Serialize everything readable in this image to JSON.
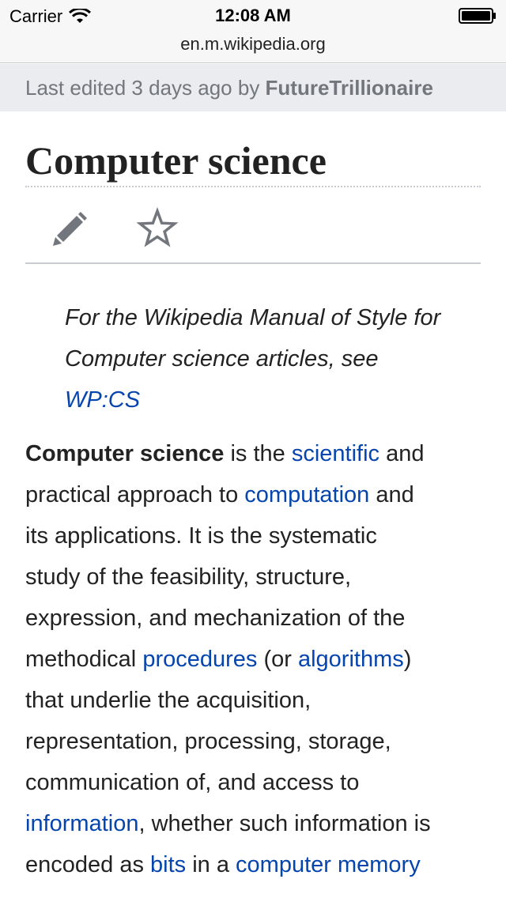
{
  "status_bar": {
    "carrier": "Carrier",
    "time": "12:08 AM"
  },
  "url_bar": {
    "url": "en.m.wikipedia.org"
  },
  "banner": {
    "prefix": "Last edited 3 days ago by ",
    "editor": "FutureTrillionaire"
  },
  "article": {
    "title": "Computer science",
    "hatnote": {
      "text_1": "For the Wikipedia Manual of Style for",
      "text_2": "Computer science articles, see",
      "link": "WP:CS"
    },
    "lead": {
      "l1_bold": "Computer science",
      "l1_t1": " is the ",
      "l1_link": "scientific",
      "l1_t2": " and",
      "l2_t1": "practical approach to ",
      "l2_link": "computation",
      "l2_t2": " and",
      "l3": "its applications. It is the systematic",
      "l4": "study of the feasibility, structure,",
      "l5": "expression, and mechanization of the",
      "l6_t1": "methodical ",
      "l6_link1": "procedures",
      "l6_t2": " (or ",
      "l6_link2": "algorithms",
      "l6_t3": ")",
      "l7": "that underlie the acquisition,",
      "l8": "representation, processing, storage,",
      "l9": "communication of, and access to",
      "l10_link": "information",
      "l10_t1": ", whether such information is",
      "l11_t1": "encoded as ",
      "l11_link1": "bits",
      "l11_t2": " in a ",
      "l11_link2": "computer memory"
    }
  },
  "colors": {
    "link": "#0645ad",
    "banner_bg": "#eaecf0",
    "text": "#222222",
    "muted": "#72777d"
  },
  "icons": {
    "edit": "pencil-icon",
    "watch": "star-icon"
  }
}
